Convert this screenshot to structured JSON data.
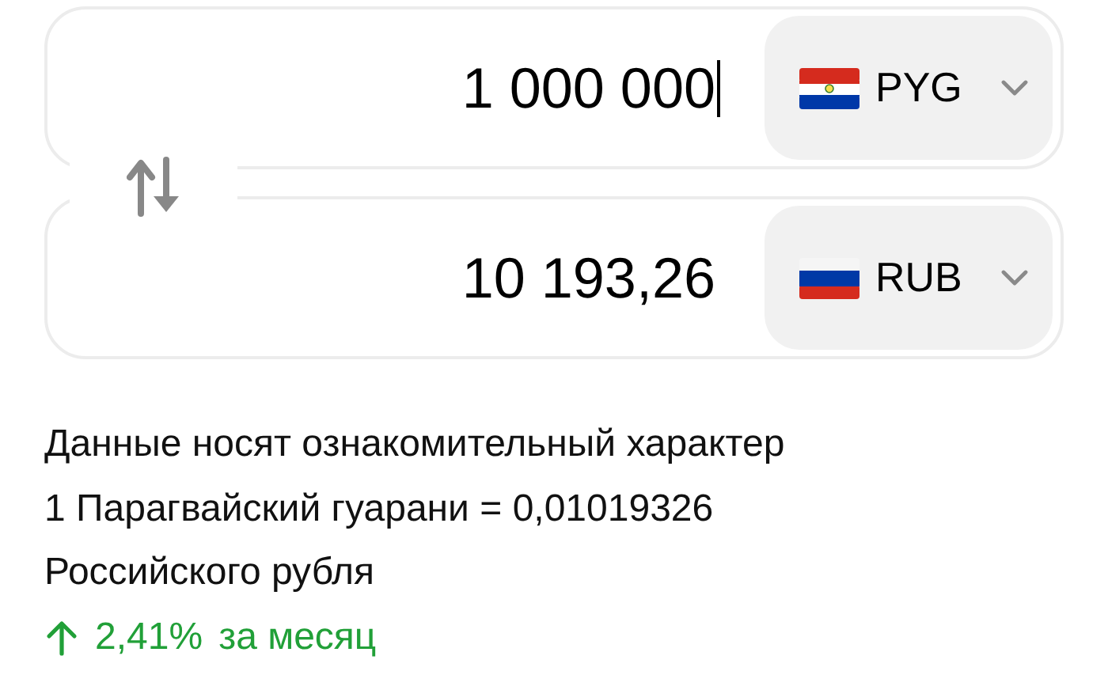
{
  "converter": [
    {
      "amount": "1 000 000",
      "focused": true,
      "currency": {
        "code": "PYG",
        "kind": "paraguay"
      }
    },
    {
      "amount": "10 193,26",
      "focused": false,
      "currency": {
        "code": "RUB",
        "kind": "russia"
      }
    }
  ],
  "disclaimer": "Данные носят ознакомительный характер",
  "rate": "1 Парагвайский гуарани = 0,01019326 Российского рубля",
  "change": {
    "up": true,
    "value": "2,41%",
    "period": "за месяц"
  }
}
